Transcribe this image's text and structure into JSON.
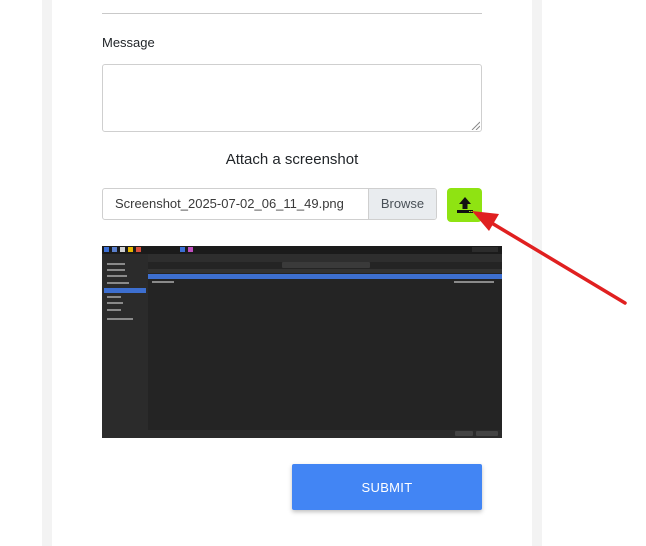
{
  "form": {
    "message_label": "Message",
    "message_value": "",
    "attach_title": "Attach a screenshot",
    "file_name": "Screenshot_2025-07-02_06_11_49.png",
    "browse_label": "Browse",
    "submit_label": "SUBMIT"
  },
  "colors": {
    "upload_button": "#8fe312",
    "submit_button": "#4285f4",
    "annotation_arrow": "#e02020"
  },
  "icons": {
    "upload": "upload-icon"
  }
}
